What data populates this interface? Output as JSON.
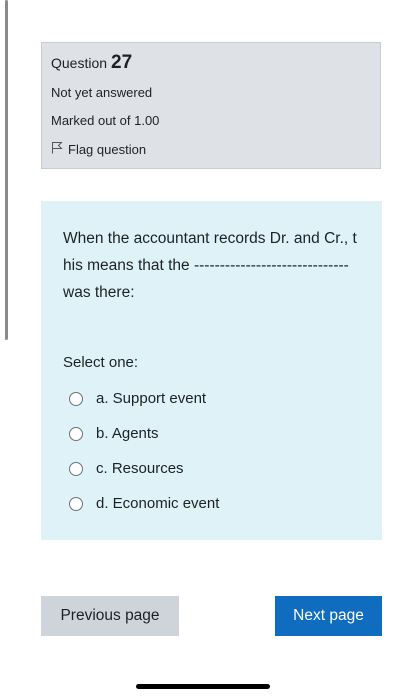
{
  "question_info": {
    "question_label": "Question",
    "question_number": "27",
    "status": "Not yet answered",
    "marks": "Marked out of 1.00",
    "flag_label": "Flag question"
  },
  "question": {
    "text": "When the accountant records Dr. and Cr., this means that the ------------------------------ was there:",
    "select_label": "Select one:",
    "options": [
      {
        "label": "a. Support event"
      },
      {
        "label": "b. Agents"
      },
      {
        "label": "c. Resources"
      },
      {
        "label": "d. Economic event"
      }
    ]
  },
  "navigation": {
    "previous_label": "Previous page",
    "next_label": "Next page"
  },
  "colors": {
    "info_bg": "#dee2e6",
    "question_bg": "#def2f8",
    "primary": "#0f6cbf",
    "secondary": "#ced4da"
  },
  "icons": {
    "flag": "flag-outline-icon",
    "radio": "radio-unchecked-icon"
  }
}
